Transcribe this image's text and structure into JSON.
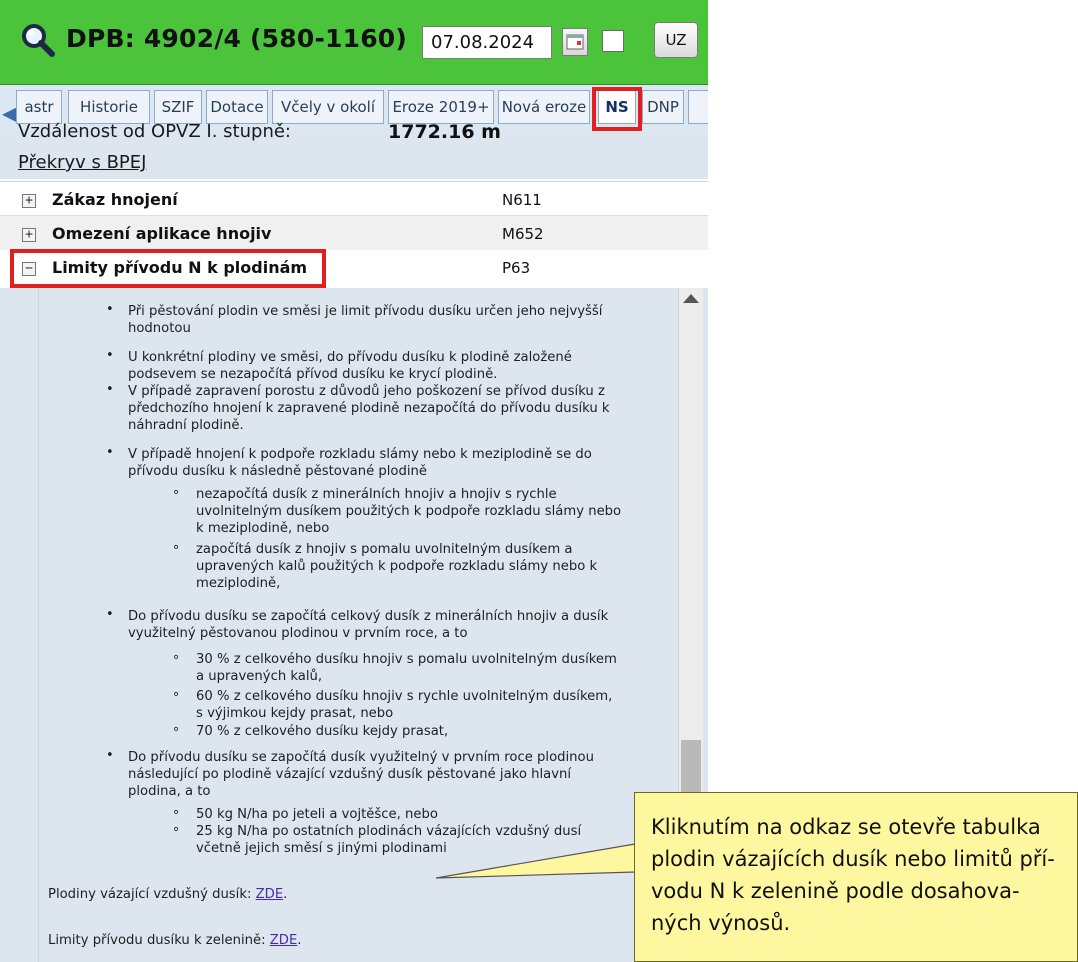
{
  "header": {
    "title": "DPB: 4902/4 (580-1160)",
    "date_value": "07.08.2024",
    "uz_label": "UZ",
    "bg_color": "#4bc43b"
  },
  "tabs": [
    {
      "label": "astr"
    },
    {
      "label": "Historie"
    },
    {
      "label": "SZIF"
    },
    {
      "label": "Dotace"
    },
    {
      "label": "Včely v okolí"
    },
    {
      "label": "Eroze 2019+"
    },
    {
      "label": "Nová eroze"
    },
    {
      "label": "NS",
      "active": true
    },
    {
      "label": "DNP"
    }
  ],
  "info": {
    "distance_label": "Vzdálenost od OPVZ I. stupně:",
    "distance_value": "1772.16 m",
    "bpej_link": "Překryv s BPEJ"
  },
  "rows": [
    {
      "label": "Zákaz hnojení",
      "code": "N611",
      "expander": "+"
    },
    {
      "label": "Omezení aplikace hnojiv",
      "code": "M652",
      "expander": "+"
    },
    {
      "label": "Limity přívodu N k plodinám",
      "code": "P63",
      "expander": "−"
    }
  ],
  "content": {
    "lines": [
      "Při pěstování plodin ve směsi je limit přívodu dusíku určen jeho nejvyšší",
      "hodnotou",
      "U konkrétní plodiny ve směsi, do přívodu dusíku k plodině založené",
      "podsevem se nezapočítá přívod dusíku ke krycí plodině.",
      "V případě zapravení porostu z důvodů jeho poškození se přívod dusíku z",
      "předchozího hnojení k zapravené plodině nezapočítá do přívodu dusíku k",
      "náhradní plodině.",
      "V případě hnojení k podpoře rozkladu slámy nebo k meziplodině se do",
      "přívodu dusíku k následně pěstované plodině",
      "nezapočítá dusík z minerálních hnojiv a hnojiv s rychle",
      "uvolnitelným dusíkem použitých k podpoře rozkladu slámy nebo",
      "k meziplodině, nebo",
      "započítá dusík z hnojiv s pomalu uvolnitelným dusíkem a",
      "upravených kalů použitých k podpoře rozkladu slámy nebo k",
      "meziplodině,",
      "Do přívodu dusíku se započítá celkový dusík z minerálních hnojiv a dusík",
      "využitelný pěstovanou plodinou v prvním roce, a to",
      "30 % z celkového dusíku hnojiv s pomalu uvolnitelným dusíkem",
      "a upravených kalů,",
      "60 % z celkového dusíku hnojiv s rychle uvolnitelným dusíkem,",
      "s výjimkou kejdy prasat, nebo",
      "70 % z celkového dusíku kejdy prasat,",
      "Do přívodu dusíku se započítá dusík využitelný v prvním roce plodinou",
      "následující po plodině vázající vzdušný dusík pěstované jako hlavní",
      "plodina, a to",
      "50 kg N/ha po jeteli a vojtěšce, nebo",
      "25 kg N/ha po ostatních plodinách vázajících vzdušný dusí",
      "včetně jejich směsí s jinými plodinami"
    ],
    "crops_label": "Plodiny vázající vzdušný dusík: ",
    "crops_link": "ZDE",
    "veg_label": "Limity přívodu dusíku k zelenině: ",
    "veg_link": "ZDE",
    "period": "."
  },
  "callout": {
    "lines": [
      "Kliknutím na odkaz se otevře tabulka",
      "plodin vázajících dusík nebo limitů pří-",
      "vodu N k zelenině podle dosahova-",
      "ných výnosů."
    ]
  }
}
